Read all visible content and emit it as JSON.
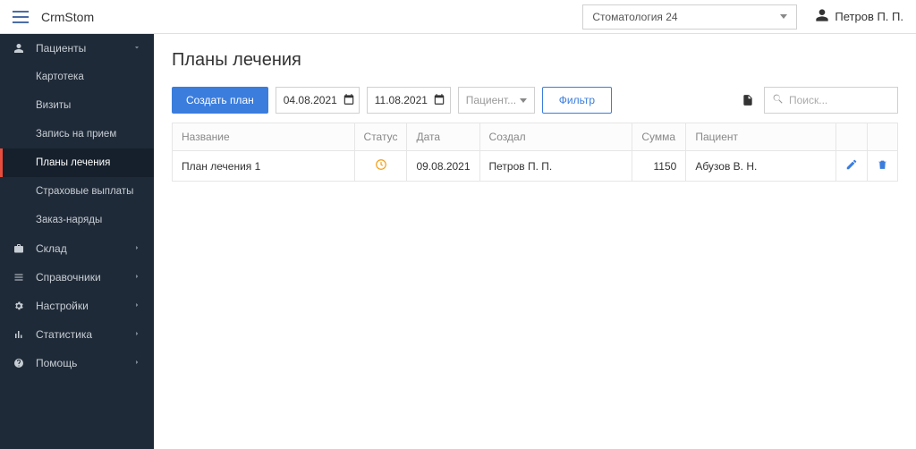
{
  "app_title": "CrmStom",
  "org_select": {
    "value": "Стоматология 24"
  },
  "user": {
    "name": "Петров П. П."
  },
  "sidebar": {
    "patients": {
      "label": "Пациенты"
    },
    "sub": {
      "card": "Картотека",
      "visits": "Визиты",
      "appoint": "Запись на прием",
      "plans": "Планы лечения",
      "insurance": "Страховые выплаты",
      "orders": "Заказ-наряды"
    },
    "stock": "Склад",
    "refs": "Справочники",
    "settings": "Настройки",
    "stats": "Статистика",
    "help": "Помощь"
  },
  "page": {
    "title": "Планы лечения",
    "create_btn": "Создать план",
    "date_from": "04.08.2021",
    "date_to": "11.08.2021",
    "patient_placeholder": "Пациент...",
    "filter_btn": "Фильтр",
    "search_placeholder": "Поиск..."
  },
  "table": {
    "headers": {
      "name": "Название",
      "status": "Статус",
      "date": "Дата",
      "creator": "Создал",
      "sum": "Сумма",
      "patient": "Пациент"
    },
    "rows": [
      {
        "name": "План лечения 1",
        "date": "09.08.2021",
        "creator": "Петров П. П.",
        "sum": "1150",
        "patient": "Абузов В. Н."
      }
    ]
  }
}
